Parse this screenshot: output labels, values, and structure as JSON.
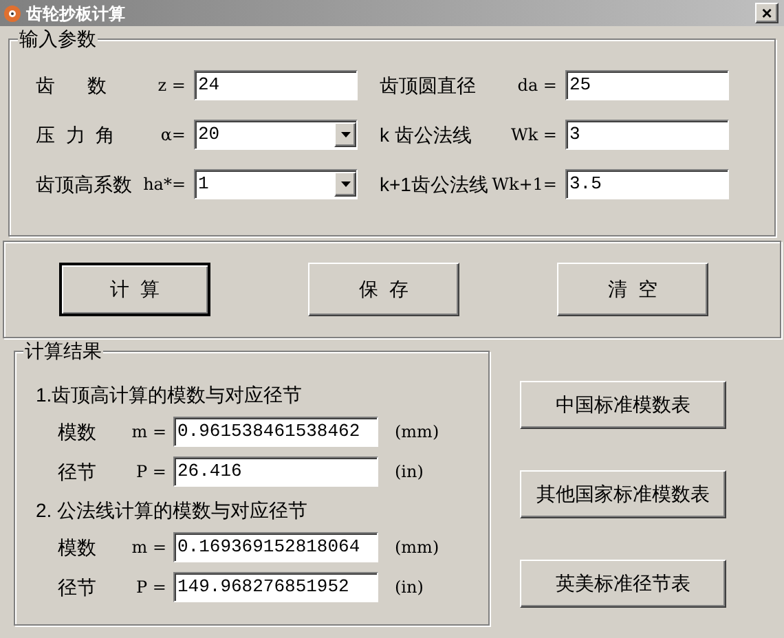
{
  "window": {
    "title": "齿轮抄板计算",
    "close": "×"
  },
  "input_group": {
    "title": "输入参数",
    "rows": [
      {
        "left": {
          "label": "齿      数",
          "symbol": "z =",
          "value": "24",
          "kind": "text"
        },
        "right": {
          "label": "齿顶圆直径",
          "symbol": "da =",
          "value": "25",
          "kind": "text"
        }
      },
      {
        "left": {
          "label": "压  力  角",
          "symbol": "α=",
          "value": "20",
          "kind": "dropdown"
        },
        "right": {
          "label": "k 齿公法线",
          "symbol": "Wk =",
          "value": "3",
          "kind": "text"
        }
      },
      {
        "left": {
          "label": "齿顶高系数",
          "symbol": "ha*=",
          "value": "1",
          "kind": "dropdown"
        },
        "right": {
          "label": "k+1齿公法线",
          "symbol": "Wk+1=",
          "value": "3.5",
          "kind": "text"
        }
      }
    ]
  },
  "actions": [
    {
      "label": "计  算",
      "default": true
    },
    {
      "label": "保  存",
      "default": false
    },
    {
      "label": "清  空",
      "default": false
    }
  ],
  "results_group": {
    "title": "计算结果",
    "sections": [
      {
        "heading": "1.齿顶高计算的模数与对应径节",
        "fields": [
          {
            "label": "模数",
            "symbol": "m =",
            "value": "0.961538461538462",
            "unit": "(mm)"
          },
          {
            "label": "径节",
            "symbol": "P =",
            "value": "26.416",
            "unit": "(in)"
          }
        ]
      },
      {
        "heading": "2. 公法线计算的模数与对应径节",
        "fields": [
          {
            "label": "模数",
            "symbol": "m =",
            "value": "0.169369152818064",
            "unit": "(mm)"
          },
          {
            "label": "径节",
            "symbol": "P =",
            "value": "149.968276851952",
            "unit": "(in)"
          }
        ]
      }
    ]
  },
  "table_buttons": [
    "中国标准模数表",
    "其他国家标准模数表",
    "英美标准径节表"
  ]
}
